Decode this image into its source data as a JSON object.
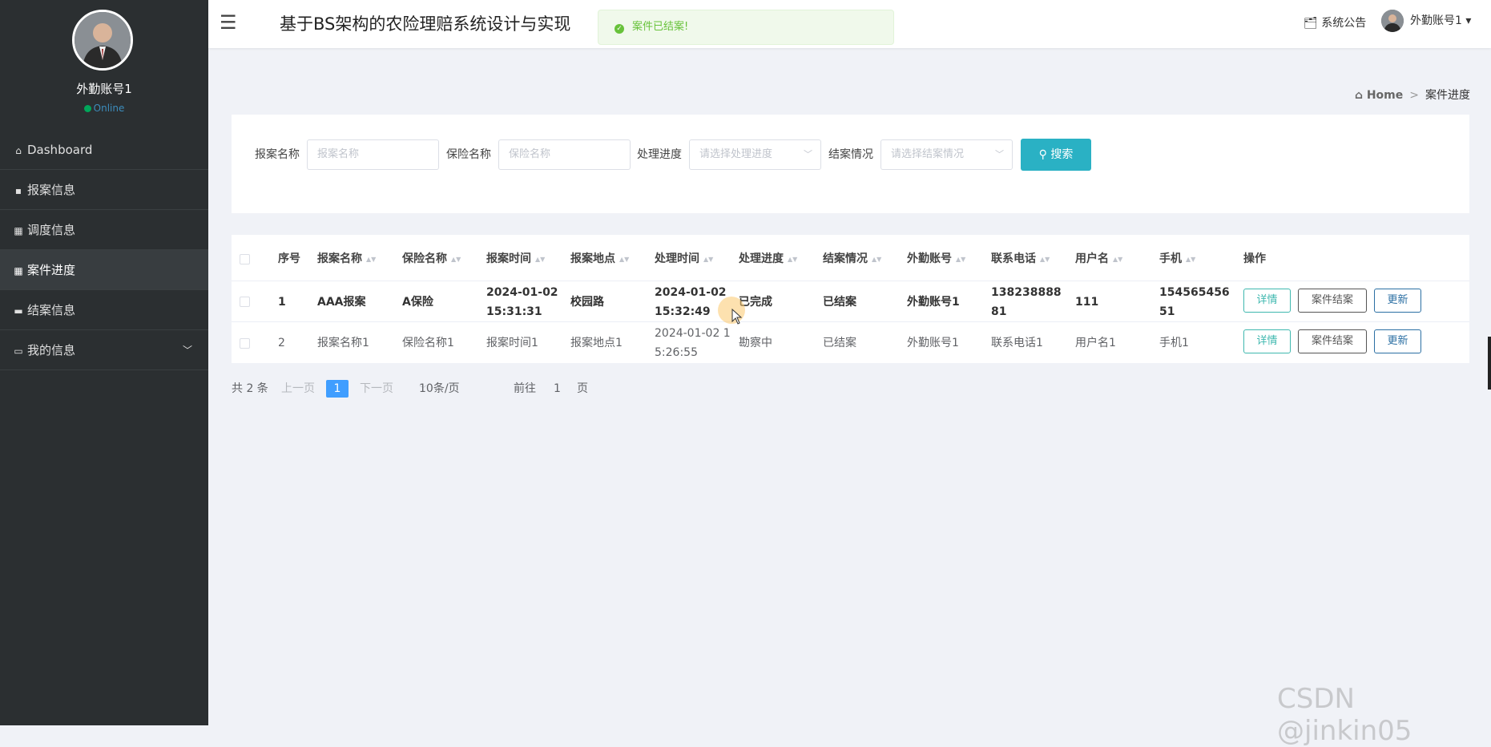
{
  "sidebar": {
    "username": "外勤账号1",
    "status": "Online",
    "items": [
      {
        "icon": "home-icon",
        "glyph": "⌂",
        "label": "Dashboard"
      },
      {
        "icon": "document-icon",
        "glyph": "▪",
        "label": "报案信息"
      },
      {
        "icon": "grid-icon",
        "glyph": "▦",
        "label": "调度信息"
      },
      {
        "icon": "grid-icon",
        "glyph": "▦",
        "label": "案件进度"
      },
      {
        "icon": "chat-icon",
        "glyph": "▬",
        "label": "结案信息"
      },
      {
        "icon": "user-card-icon",
        "glyph": "▭",
        "label": "我的信息"
      }
    ]
  },
  "header": {
    "title": "基于BS架构的农险理赔系统设计与实现",
    "toast": "案件已结案!",
    "notice": "系统公告",
    "user": "外勤账号1"
  },
  "breadcrumb": {
    "home": "Home",
    "current": "案件进度"
  },
  "search": {
    "f1_label": "报案名称",
    "f1_placeholder": "报案名称",
    "f2_label": "保险名称",
    "f2_placeholder": "保险名称",
    "f3_label": "处理进度",
    "f3_placeholder": "请选择处理进度",
    "f4_label": "结案情况",
    "f4_placeholder": "请选择结案情况",
    "button": "搜索"
  },
  "table": {
    "headers": [
      "序号",
      "报案名称",
      "保险名称",
      "报案时间",
      "报案地点",
      "处理时间",
      "处理进度",
      "结案情况",
      "外勤账号",
      "联系电话",
      "用户名",
      "手机",
      "操作"
    ],
    "rows": [
      {
        "no": "1",
        "case": "AAA报案",
        "ins": "A保险",
        "time_a": "2024-01-02",
        "time_b": "15:31:31",
        "place": "校园路",
        "ptime_a": "2024-01-02",
        "ptime_b": "15:32:49",
        "progress": "已完成",
        "closed": "已结案",
        "account": "外勤账号1",
        "phone_a": "138238888",
        "phone_b": "81",
        "uname": "111",
        "mobile_a": "154565456",
        "mobile_b": "51"
      },
      {
        "no": "2",
        "case": "报案名称1",
        "ins": "保险名称1",
        "time_a": "报案时间1",
        "place": "报案地点1",
        "ptime_a": "2024-01-02 1",
        "ptime_b": "5:26:55",
        "progress": "勘察中",
        "closed": "已结案",
        "account": "外勤账号1",
        "phone_a": "联系电话1",
        "uname": "用户名1",
        "mobile_a": "手机1"
      }
    ],
    "actions": {
      "detail": "详情",
      "close": "案件结案",
      "update": "更新"
    }
  },
  "pager": {
    "total": "共 2 条",
    "prev": "上一页",
    "current": "1",
    "next": "下一页",
    "size": "10条/页",
    "goto": "前往",
    "goto_value": "1",
    "page_unit": "页"
  },
  "watermark": "CSDN @jinkin05"
}
